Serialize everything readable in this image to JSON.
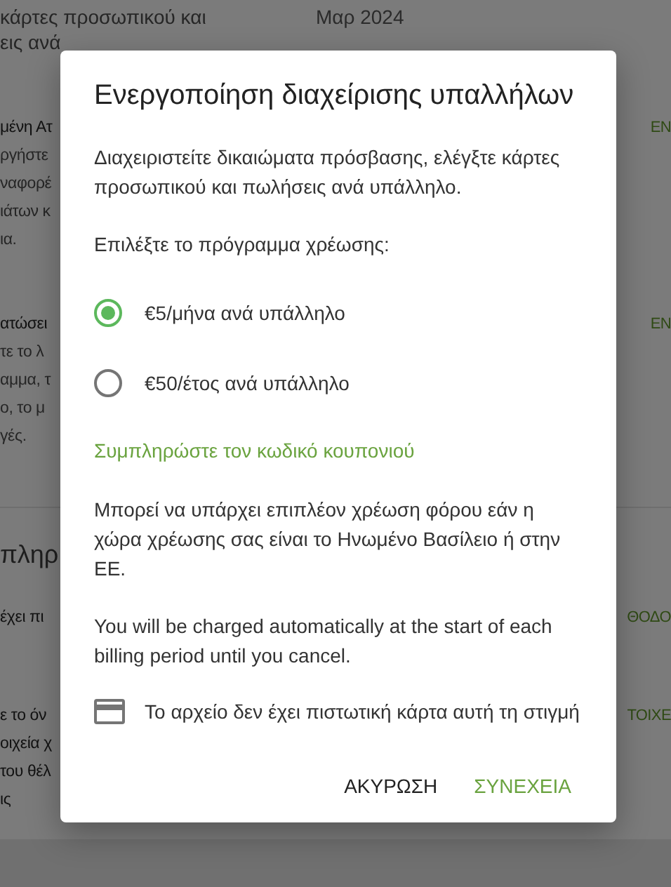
{
  "background": {
    "header_lines": [
      "κάρτες προσωπικού και",
      "εις ανά"
    ],
    "date": "Μαρ 2024",
    "sections": [
      {
        "lines": [
          "μένη Ατ",
          "ργήστε",
          "ναφορέ",
          "ιάτων κ",
          "ια."
        ],
        "action": "ΕΝ"
      },
      {
        "lines": [
          "ατώσει",
          "τε το λ",
          "αμμα, τ",
          "ο, το μ",
          "γές."
        ],
        "action": "ΕΝ"
      }
    ],
    "heading": "πληρ",
    "sections_2": [
      {
        "lines": [
          "έχει πι"
        ],
        "action": "ΘΟΔΟ"
      },
      {
        "lines": [
          "ε το όν",
          "οιχεία χ",
          "του θέλ",
          "ις"
        ],
        "action": "ΤΟΙΧΕ"
      }
    ]
  },
  "dialog": {
    "title": "Ενεργοποίηση διαχείρισης υπαλλήλων",
    "description": "Διαχειριστείτε δικαιώματα πρόσβασης, ελέγξτε κάρτες προσωπικού και πωλήσεις ανά υπάλληλο.",
    "plan_prompt": "Επιλέξτε το πρόγραμμα χρέωσης:",
    "plans": [
      {
        "label": "€5/μήνα ανά υπάλληλο",
        "selected": true
      },
      {
        "label": "€50/έτος ανά υπάλληλο",
        "selected": false
      }
    ],
    "coupon_link": "Συμπληρώστε τον κωδικό κουπονιού",
    "tax_note": "Μπορεί να υπάρχει επιπλέον χρέωση φόρου εάν η χώρα χρέωσης σας είναι το Ηνωμένο Βασίλειο ή στην ΕΕ.",
    "billing_note": "You will be charged automatically at the start of each billing period until you cancel.",
    "card_notice": "Το αρχείο δεν έχει πιστωτική κάρτα αυτή τη στιγμή",
    "buttons": [
      {
        "label": "ΑΚΥΡΩΣΗ",
        "kind": "cancel"
      },
      {
        "label": "ΣΥΝΕΧΕΙΑ",
        "kind": "confirm"
      }
    ]
  }
}
